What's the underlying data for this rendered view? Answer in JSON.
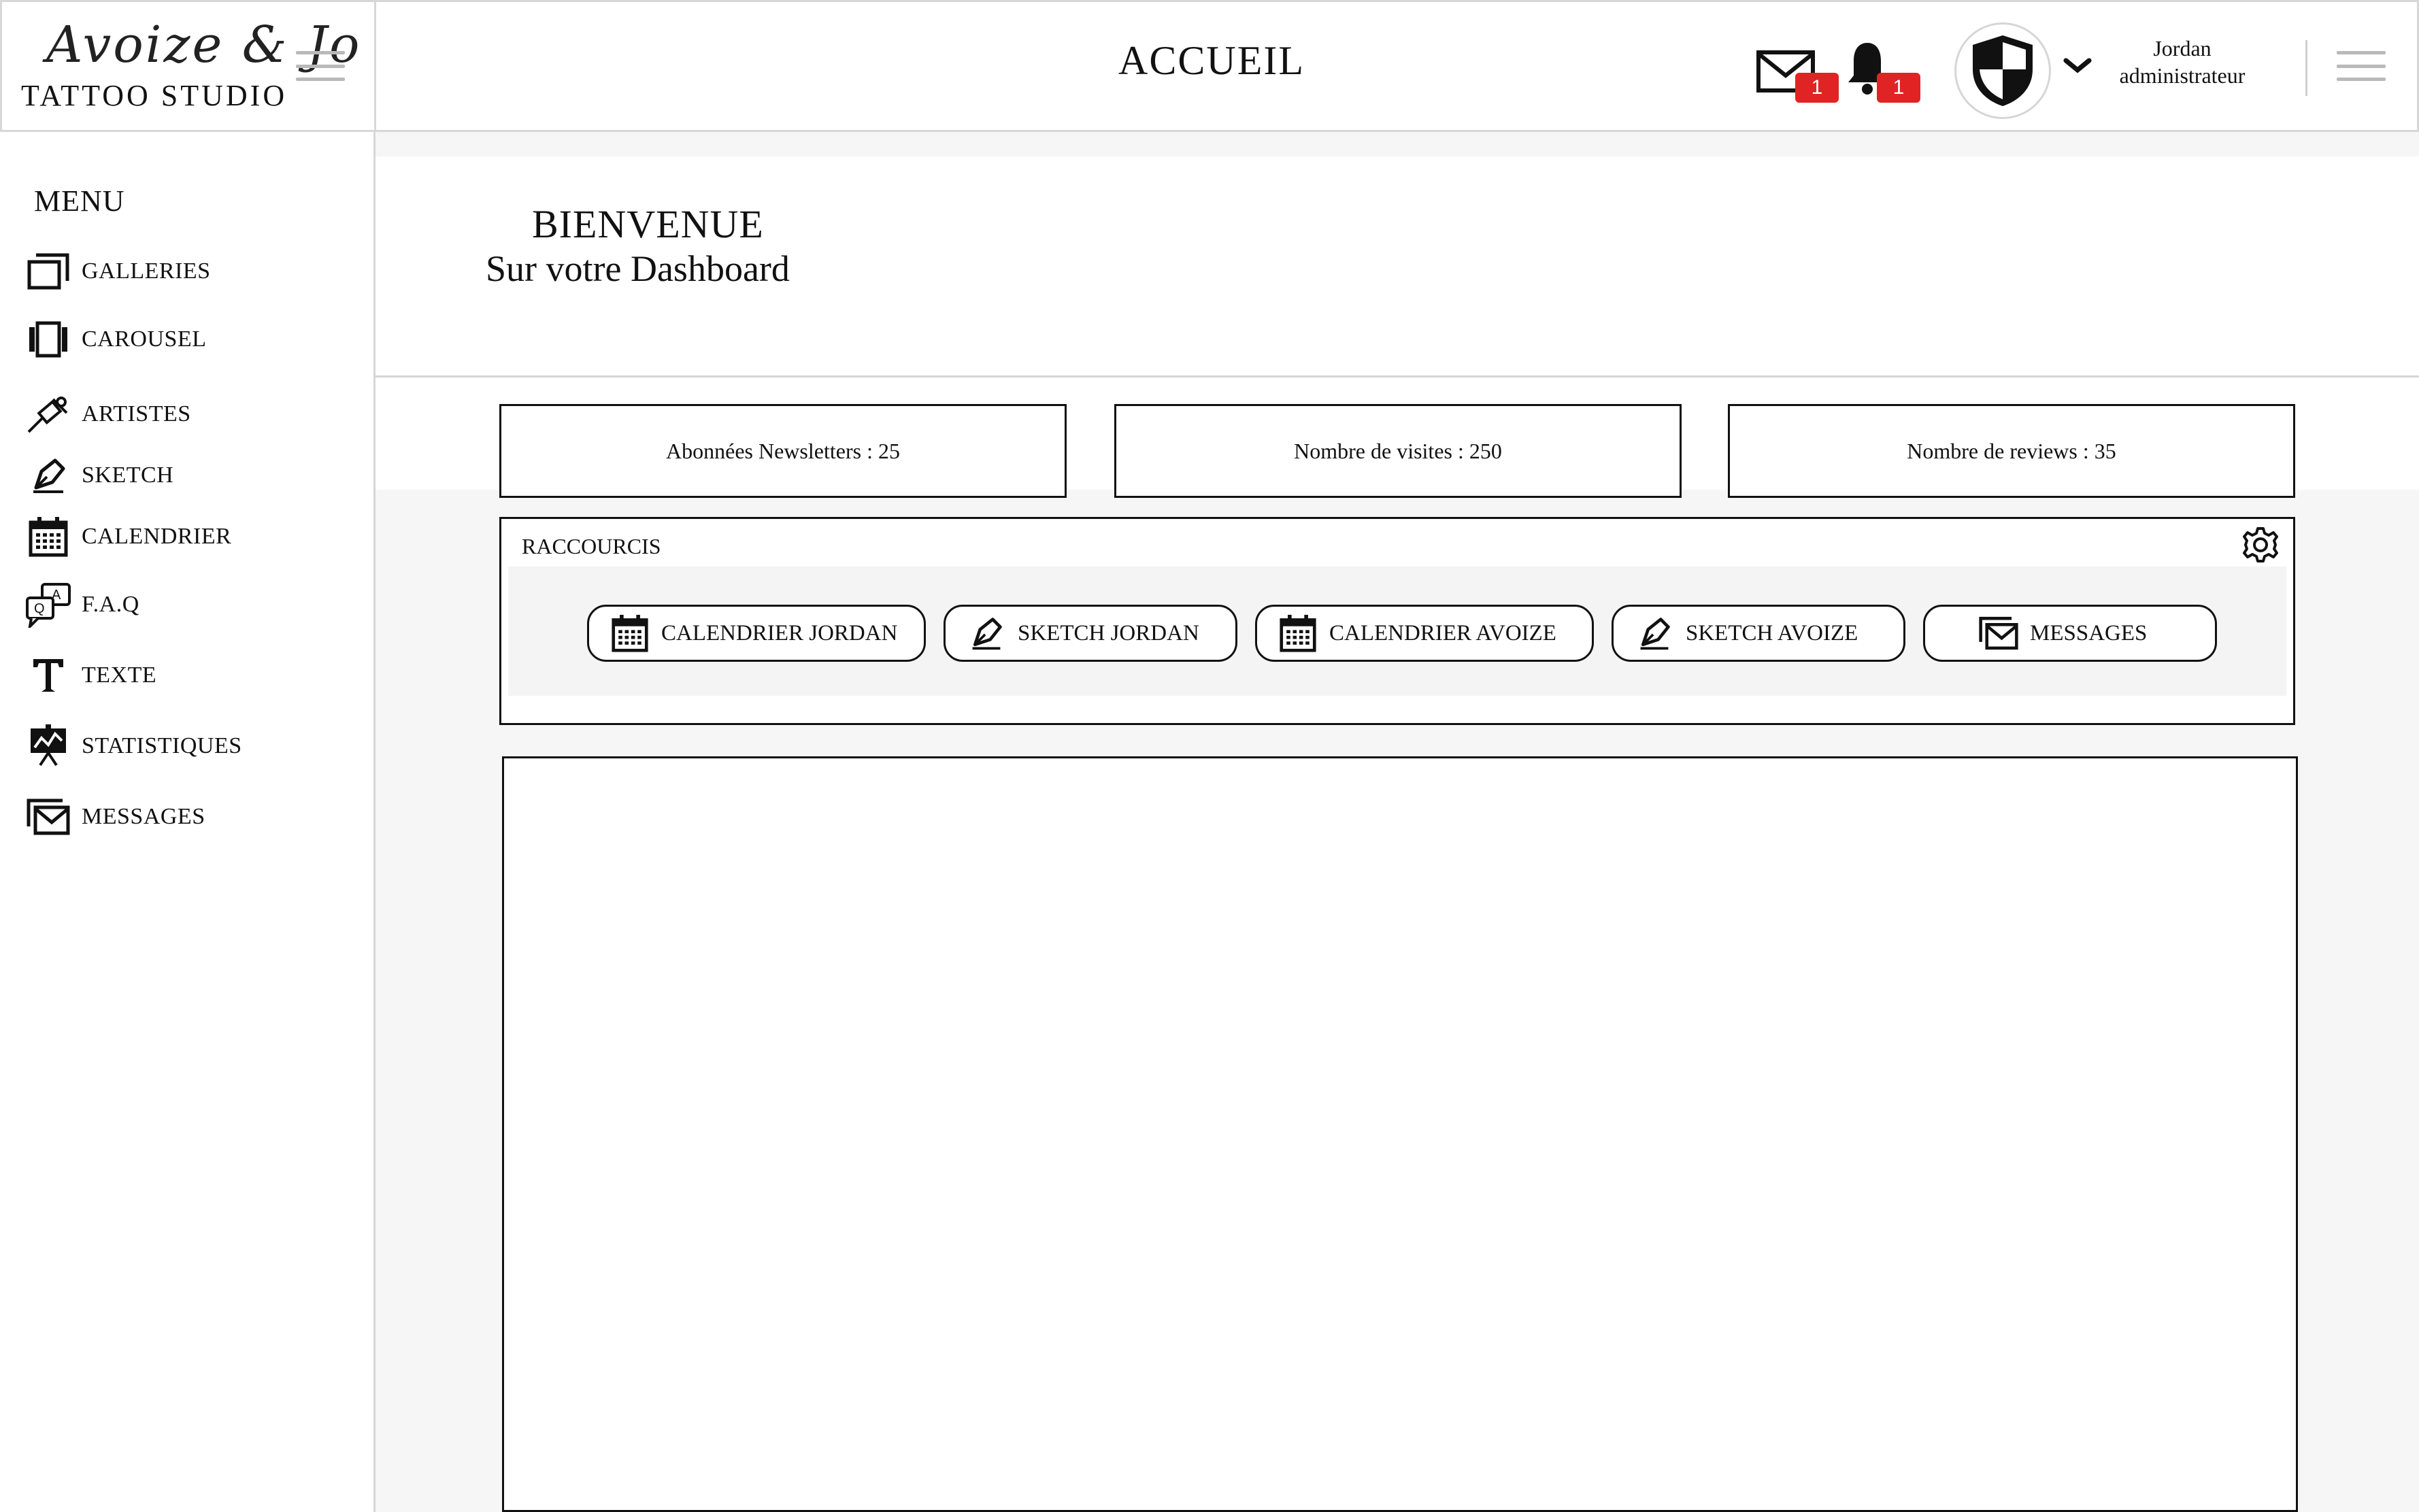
{
  "brand": {
    "script": "Avoize & Jo",
    "studio": "Tattoo studio"
  },
  "header": {
    "title": "ACCUEIL",
    "mail_badge": "1",
    "bell_badge": "1",
    "user_name": "Jordan",
    "user_role": "administrateur"
  },
  "sidebar": {
    "title": "MENU",
    "items": [
      {
        "label": "GALLERIES",
        "icon": "gallery-icon"
      },
      {
        "label": "CAROUSEL",
        "icon": "carousel-icon"
      },
      {
        "label": "ARTISTES",
        "icon": "tattoo-machine-icon"
      },
      {
        "label": "SKETCH",
        "icon": "pen-icon"
      },
      {
        "label": "CALENDRIER",
        "icon": "calendar-icon"
      },
      {
        "label": "F.A.Q",
        "icon": "qa-icon"
      },
      {
        "label": "TEXTE",
        "icon": "text-icon"
      },
      {
        "label": "STATISTIQUES",
        "icon": "statistics-icon"
      },
      {
        "label": "MESSAGES",
        "icon": "messages-icon"
      }
    ]
  },
  "welcome": {
    "line1": "BIENVENUE",
    "line2": "Sur votre Dashboard"
  },
  "stats": [
    {
      "label": "Abonnées Newsletters : 25"
    },
    {
      "label": "Nombre de visites : 250"
    },
    {
      "label": "Nombre de reviews : 35"
    }
  ],
  "shortcuts": {
    "title": "RACCOURCIS",
    "buttons": [
      {
        "label": "CALENDRIER JORDAN",
        "icon": "calendar-icon"
      },
      {
        "label": "SKETCH JORDAN",
        "icon": "pen-icon"
      },
      {
        "label": "CALENDRIER AVOIZE",
        "icon": "calendar-icon"
      },
      {
        "label": "SKETCH AVOIZE",
        "icon": "pen-icon"
      },
      {
        "label": "MESSAGES",
        "icon": "messages-icon"
      }
    ]
  },
  "colors": {
    "badge": "#e02424",
    "border": "#111111",
    "divider": "#d7d7d7",
    "background": "#f6f6f6"
  }
}
